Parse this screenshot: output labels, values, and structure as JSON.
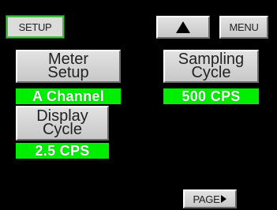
{
  "header": {
    "setup_label": "SETUP",
    "menu_label": "MENU",
    "up_icon": "up-triangle-icon"
  },
  "settings": {
    "meter_setup": {
      "line1": "Meter",
      "line2": "Setup",
      "value": "A Channel"
    },
    "sampling_cycle": {
      "line1": "Sampling",
      "line2": "Cycle",
      "value": "500 CPS"
    },
    "display_cycle": {
      "line1": "Display",
      "line2": "Cycle",
      "value": "2.5 CPS"
    }
  },
  "footer": {
    "page_label": "PAGE",
    "page_icon": "right-arrow-icon"
  },
  "colors": {
    "background": "#000000",
    "value_green": "#00ee00",
    "button_gray": "#d6d6d6",
    "setup_border": "#3fbf3f"
  }
}
